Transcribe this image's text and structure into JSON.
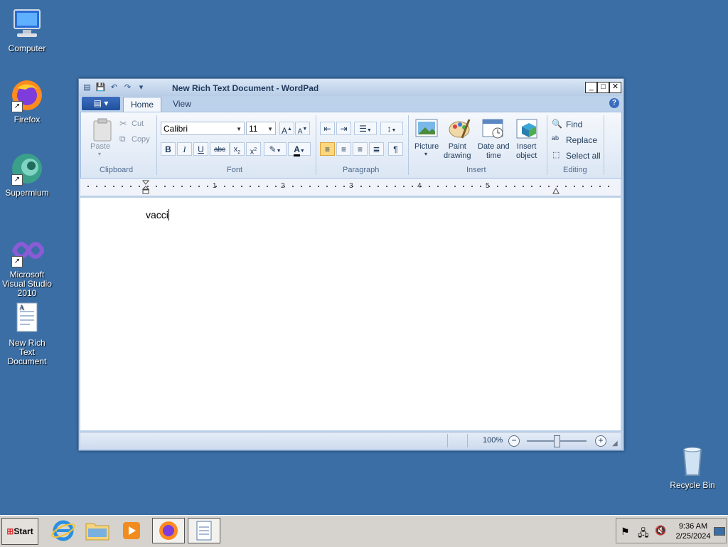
{
  "desktop": {
    "icons": [
      {
        "label": "Computer"
      },
      {
        "label": "Firefox"
      },
      {
        "label": "Supermium"
      },
      {
        "label": "Microsoft Visual Studio 2010"
      },
      {
        "label": "New Rich Text Document"
      },
      {
        "label": "Recycle Bin"
      }
    ]
  },
  "window": {
    "title": "New Rich Text Document - WordPad",
    "tabs": [
      {
        "label": "Home"
      },
      {
        "label": "View"
      }
    ],
    "ribbon": {
      "clipboard": {
        "paste": "Paste",
        "cut": "Cut",
        "copy": "Copy",
        "label": "Clipboard"
      },
      "font": {
        "family": "Calibri",
        "size": "11",
        "label": "Font"
      },
      "paragraph": {
        "label": "Paragraph"
      },
      "insert": {
        "picture": "Picture",
        "paint1": "Paint",
        "paint2": "drawing",
        "date1": "Date and",
        "date2": "time",
        "obj1": "Insert",
        "obj2": "object",
        "label": "Insert"
      },
      "editing": {
        "find": "Find",
        "replace": "Replace",
        "select_all": "Select all",
        "label": "Editing"
      }
    },
    "ruler": {
      "numbers": [
        "1",
        "2",
        "3",
        "4",
        "5"
      ]
    },
    "document": {
      "text": "vacci"
    },
    "status": {
      "zoom": "100%"
    }
  },
  "taskbar": {
    "start_label": "Start",
    "time": "9:36 AM",
    "date": "2/25/2024"
  },
  "colors": {
    "desktop": "#3a6ea5",
    "accent": "#1f4f9c",
    "highlight": "#fcd77e"
  }
}
